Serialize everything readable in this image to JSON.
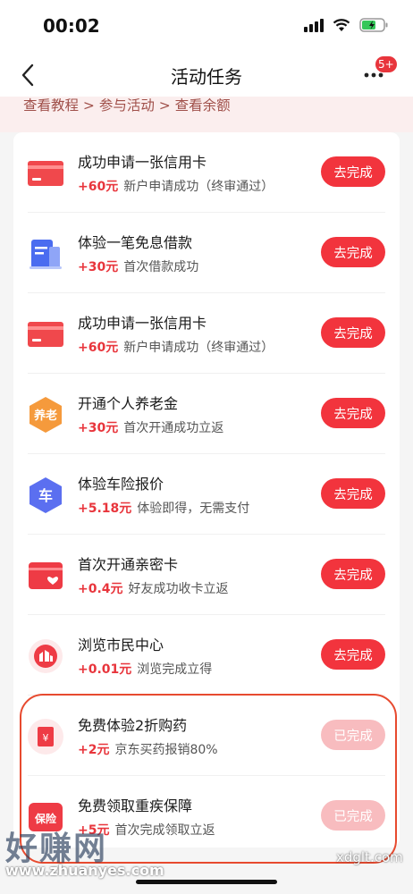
{
  "status": {
    "time": "00:02"
  },
  "nav": {
    "title": "活动任务",
    "badge": "5+"
  },
  "breadcrumb": "查看教程 > 参与活动 > 查看余额",
  "tasks": [
    {
      "icon": "credit-card-icon",
      "title": "成功申请一张信用卡",
      "amount": "+60元",
      "desc": "新户申请成功（终审通过）",
      "button": "去完成",
      "done": false
    },
    {
      "icon": "document-icon",
      "title": "体验一笔免息借款",
      "amount": "+30元",
      "desc": "首次借款成功",
      "button": "去完成",
      "done": false
    },
    {
      "icon": "credit-card-icon",
      "title": "成功申请一张信用卡",
      "amount": "+60元",
      "desc": "新户申请成功（终审通过）",
      "button": "去完成",
      "done": false
    },
    {
      "icon": "pension-icon",
      "icon_text": "养老",
      "title": "开通个人养老金",
      "amount": "+30元",
      "desc": "首次开通成功立返",
      "button": "去完成",
      "done": false
    },
    {
      "icon": "car-shield-icon",
      "icon_text": "车",
      "title": "体验车险报价",
      "amount": "+5.18元",
      "desc": "体验即得，无需支付",
      "button": "去完成",
      "done": false
    },
    {
      "icon": "heart-card-icon",
      "title": "首次开通亲密卡",
      "amount": "+0.4元",
      "desc": "好友成功收卡立返",
      "button": "去完成",
      "done": false
    },
    {
      "icon": "city-center-icon",
      "title": "浏览市民中心",
      "amount": "+0.01元",
      "desc": "浏览完成立得",
      "button": "去完成",
      "done": false
    },
    {
      "icon": "medicine-icon",
      "title": "免费体验2折购药",
      "amount": "+2元",
      "desc": "京东买药报销80%",
      "button": "已完成",
      "done": true
    },
    {
      "icon": "insurance-icon",
      "icon_text": "保险",
      "title": "免费领取重疾保障",
      "amount": "+5元",
      "desc": "首次完成领取立返",
      "button": "已完成",
      "done": true
    }
  ],
  "watermark": {
    "left": "好赚网",
    "url": "www.zhuanyes.com",
    "right": "xdglt.com"
  },
  "colors": {
    "accent": "#f2343d",
    "done": "#f8bcbf",
    "breadcrumb_bg": "#fbeeee"
  }
}
